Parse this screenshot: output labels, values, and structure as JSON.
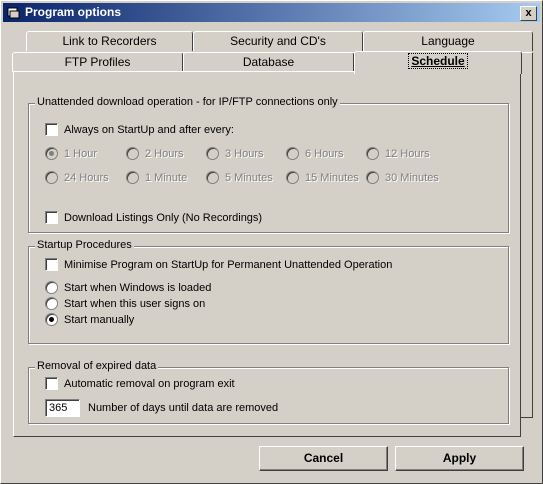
{
  "window": {
    "title": "Program options",
    "close_label": "x"
  },
  "tabs_back": [
    {
      "label": "Link to Recorders"
    },
    {
      "label": "Security and CD's"
    },
    {
      "label": "Language"
    }
  ],
  "tabs_front": [
    {
      "label": "FTP Profiles"
    },
    {
      "label": "Database"
    },
    {
      "label": "Schedule"
    }
  ],
  "unattended": {
    "legend": "Unattended download operation - for IP/FTP connections only",
    "always_label": "Always on StartUp and after every:",
    "always_checked": false,
    "intervals": [
      "1 Hour",
      "2 Hours",
      "3 Hours",
      "6 Hours",
      "12 Hours",
      "24 Hours",
      "1 Minute",
      "5 Minutes",
      "15 Minutes",
      "30 Minutes"
    ],
    "selected_interval": "1 Hour",
    "download_only_label": "Download Listings Only (No Recordings)",
    "download_only_checked": false
  },
  "startup": {
    "legend": "Startup Procedures",
    "minimise_label": "Minimise Program on StartUp for Permanent Unattended Operation",
    "options": [
      "Start when Windows is loaded",
      "Start when this user signs on",
      "Start manually"
    ],
    "selected": "Start manually"
  },
  "removal": {
    "legend": "Removal of expired data",
    "auto_label": "Automatic removal on program exit",
    "days_value": "365",
    "days_label": "Number of days until data are removed"
  },
  "buttons": {
    "cancel": "Cancel",
    "apply": "Apply"
  }
}
